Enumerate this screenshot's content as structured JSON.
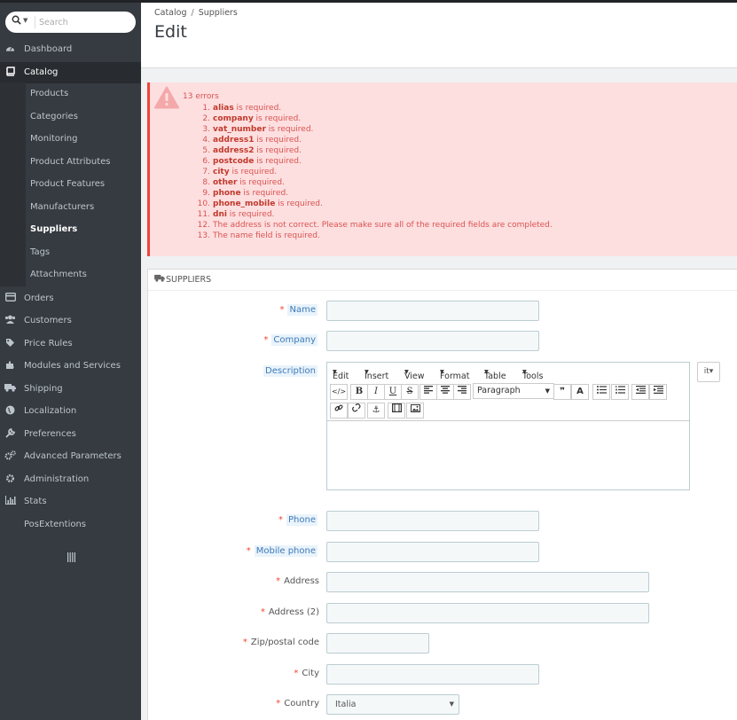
{
  "sidebar": {
    "search_placeholder": "Search",
    "items": [
      {
        "label": "Dashboard",
        "icon": "dashboard-icon"
      },
      {
        "label": "Catalog",
        "icon": "catalog-icon"
      },
      {
        "label": "Orders",
        "icon": "orders-icon"
      },
      {
        "label": "Customers",
        "icon": "customers-icon"
      },
      {
        "label": "Price Rules",
        "icon": "price-rules-icon"
      },
      {
        "label": "Modules and Services",
        "icon": "modules-icon"
      },
      {
        "label": "Shipping",
        "icon": "shipping-icon"
      },
      {
        "label": "Localization",
        "icon": "globe-icon"
      },
      {
        "label": "Preferences",
        "icon": "wrench-icon"
      },
      {
        "label": "Advanced Parameters",
        "icon": "gears-icon"
      },
      {
        "label": "Administration",
        "icon": "gear-icon"
      },
      {
        "label": "Stats",
        "icon": "stats-icon"
      },
      {
        "label": "PosExtentions",
        "icon": ""
      }
    ],
    "catalog_sub": [
      "Products",
      "Categories",
      "Monitoring",
      "Product Attributes",
      "Product Features",
      "Manufacturers",
      "Suppliers",
      "Tags",
      "Attachments"
    ]
  },
  "header": {
    "breadcrumb": [
      "Catalog",
      "Suppliers"
    ],
    "title": "Edit"
  },
  "errors": {
    "title": "13 errors",
    "items": [
      {
        "num": "1.",
        "field": "alias",
        "text": " is required."
      },
      {
        "num": "2.",
        "field": "company",
        "text": " is required."
      },
      {
        "num": "3.",
        "field": "vat_number",
        "text": " is required."
      },
      {
        "num": "4.",
        "field": "address1",
        "text": " is required."
      },
      {
        "num": "5.",
        "field": "address2",
        "text": " is required."
      },
      {
        "num": "6.",
        "field": "postcode",
        "text": " is required."
      },
      {
        "num": "7.",
        "field": "city",
        "text": " is required."
      },
      {
        "num": "8.",
        "field": "other",
        "text": " is required."
      },
      {
        "num": "9.",
        "field": "phone",
        "text": " is required."
      },
      {
        "num": "10.",
        "field": "phone_mobile",
        "text": " is required."
      },
      {
        "num": "11.",
        "field": "dni",
        "text": " is required."
      },
      {
        "num": "12.",
        "field": "",
        "text": "The address is not correct. Please make sure all of the required fields are completed."
      },
      {
        "num": "13.",
        "field": "",
        "text": "The name field is required."
      }
    ]
  },
  "panel": {
    "heading": "SUPPLIERS",
    "fields": {
      "name": "Name",
      "company": "Company",
      "description": "Description",
      "phone": "Phone",
      "mobile_phone": "Mobile phone",
      "address": "Address",
      "address2": "Address (2)",
      "zip": "Zip/postal code",
      "city": "City",
      "country": "Country"
    },
    "required_mark": "*",
    "country_value": "Italia",
    "lang": "it"
  },
  "editor": {
    "menus": [
      "Edit",
      "Insert",
      "View",
      "Format",
      "Table",
      "Tools"
    ],
    "paragraph": "Paragraph"
  },
  "colors": {
    "sidebar_bg": "#363a41",
    "alert_bg": "#fddfe0",
    "alert_text": "#d9534f",
    "required": "#f44336"
  }
}
